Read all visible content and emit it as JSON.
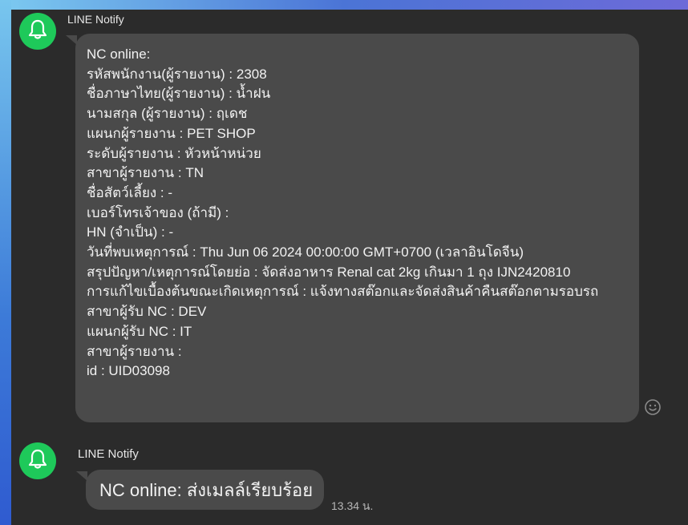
{
  "messages": [
    {
      "sender": "LINE Notify",
      "lines": [
        "NC online:",
        "รหัสพนักงาน(ผู้รายงาน) : 2308",
        "ชื่อภาษาไทย(ผู้รายงาน)  : น้ำฝน",
        "นามสกุล (ผู้รายงาน) : ฤเดช",
        "แผนกผู้รายงาน : PET SHOP",
        "ระดับผู้รายงาน : หัวหน้าหน่วย",
        "สาขาผู้รายงาน : TN",
        "ชื่อสัตว์เลี้ยง : -",
        "เบอร์โทรเจ้าของ (ถ้ามี) :",
        "HN (จำเป็น) : -",
        "วันที่พบเหตุการณ์ : Thu Jun 06 2024 00:00:00 GMT+0700 (เวลาอินโดจีน)",
        "สรุปปัญหา/เหตุการณ์โดยย่อ  : จัดส่งอาหาร Renal cat 2kg เกินมา 1 ถุง IJN2420810",
        "การแก้ไขเบื้องต้นขณะเกิดเหตุการณ์ : แจ้งทางสต๊อกและจัดส่งสินค้าคืนสต๊อกตามรอบรถ",
        "สาขาผู้รับ NC : DEV",
        "แผนกผู้รับ NC : IT",
        "สาขาผู้รายงาน :",
        "id : UID03098"
      ]
    },
    {
      "sender": "LINE Notify",
      "text": "NC online: ส่งเมลล์เรียบร้อย",
      "time": "13.34 น."
    }
  ],
  "icons": {
    "avatar": "bell-icon",
    "reaction": "smiley-icon"
  },
  "colors": {
    "avatar_bg": "#1ec95a",
    "chat_bg": "#2b2b2b",
    "bubble_bg": "#4a4a4a"
  }
}
